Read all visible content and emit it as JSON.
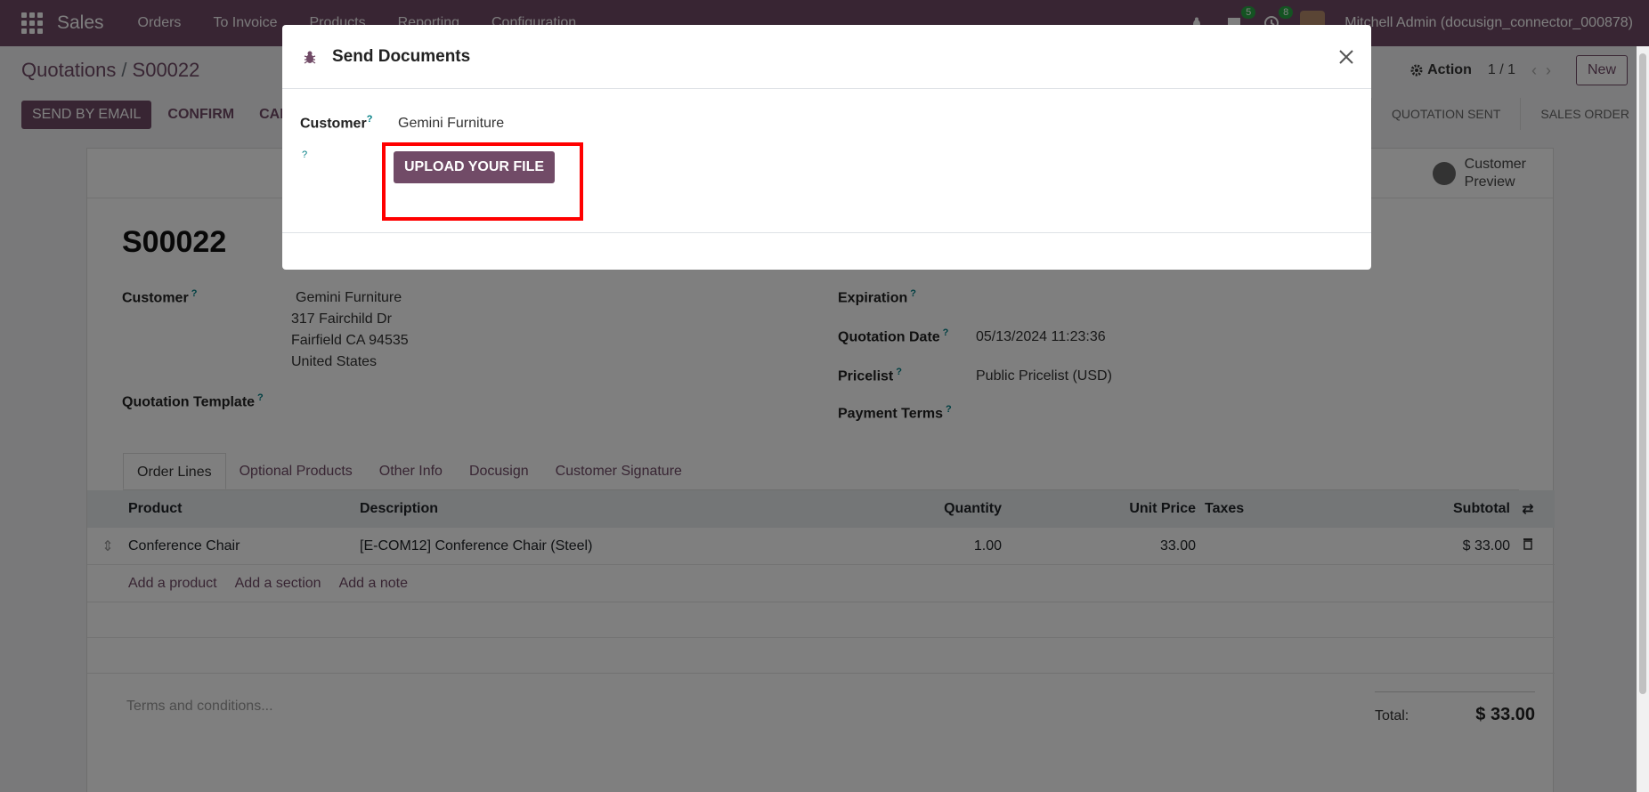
{
  "navbar": {
    "brand": "Sales",
    "menu": [
      "Orders",
      "To Invoice",
      "Products",
      "Reporting",
      "Configuration"
    ],
    "messages_count": "5",
    "activities_count": "8",
    "user": "Mitchell Admin (docusign_connector_000878)"
  },
  "control_panel": {
    "breadcrumb_parent": "Quotations",
    "breadcrumb_sep": "/",
    "breadcrumb_current": "S00022",
    "action_label": "Action",
    "pager": "1 / 1",
    "new_label": "New"
  },
  "status_buttons": {
    "send_email": "SEND BY EMAIL",
    "confirm": "CONFIRM",
    "cancel": "CAN"
  },
  "stages": [
    "QUOTATION SENT",
    "SALES ORDER"
  ],
  "form": {
    "preview_label_1": "Customer",
    "preview_label_2": "Preview",
    "title": "S00022",
    "customer_label": "Customer",
    "customer_name": "Gemini Furniture",
    "address_line1": "317 Fairchild Dr",
    "address_line2": "Fairfield CA 94535",
    "address_line3": "United States",
    "template_label": "Quotation Template",
    "expiration_label": "Expiration",
    "quotation_date_label": "Quotation Date",
    "quotation_date": "05/13/2024 11:23:36",
    "pricelist_label": "Pricelist",
    "pricelist": "Public Pricelist (USD)",
    "payment_terms_label": "Payment Terms",
    "help_mark": "?"
  },
  "tabs": [
    "Order Lines",
    "Optional Products",
    "Other Info",
    "Docusign",
    "Customer Signature"
  ],
  "table": {
    "headers": {
      "product": "Product",
      "description": "Description",
      "quantity": "Quantity",
      "unit_price": "Unit Price",
      "taxes": "Taxes",
      "subtotal": "Subtotal"
    },
    "rows": [
      {
        "product": "Conference Chair",
        "description": "[E-COM12] Conference Chair (Steel)",
        "quantity": "1.00",
        "unit_price": "33.00",
        "taxes": "",
        "subtotal": "$ 33.00"
      }
    ],
    "add_product": "Add a product",
    "add_section": "Add a section",
    "add_note": "Add a note"
  },
  "footer": {
    "terms_placeholder": "Terms and conditions...",
    "total_label": "Total:",
    "total_value": "$ 33.00"
  },
  "modal": {
    "title": "Send Documents",
    "customer_label": "Customer",
    "customer_value": "Gemini Furniture",
    "help_mark": "?",
    "upload_label": "UPLOAD YOUR FILE"
  },
  "colors": {
    "brand": "#714b67",
    "highlight": "#ff0000",
    "help": "#017e84"
  }
}
